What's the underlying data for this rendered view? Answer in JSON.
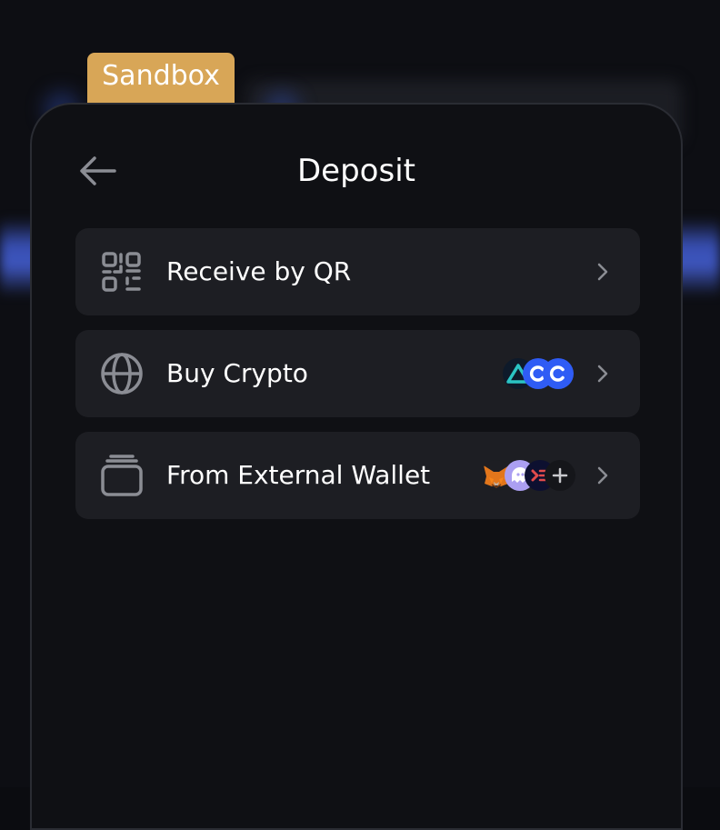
{
  "sandbox_tag": {
    "label": "Sandbox"
  },
  "header": {
    "title": "Deposit",
    "back_icon": "arrow-left-icon"
  },
  "options": [
    {
      "label": "Receive by QR",
      "icon": "qr-code-icon"
    },
    {
      "label": "Buy Crypto",
      "icon": "globe-icon",
      "providers": [
        "delta-triangle-logo",
        "coinbase-logo",
        "coinbase-logo"
      ]
    },
    {
      "label": "From External Wallet",
      "icon": "wallet-stack-icon",
      "providers": [
        "metamask-fox-logo",
        "phantom-ghost-logo",
        "hyperlane-logo",
        "plus-icon"
      ]
    }
  ],
  "colors": {
    "sandbox_tag": "#d8a657",
    "modal_bg": "#0f1014",
    "option_bg": "#1d1e23",
    "accent_blue": "#2f5cf5",
    "icon_gray": "#8b8d94"
  }
}
